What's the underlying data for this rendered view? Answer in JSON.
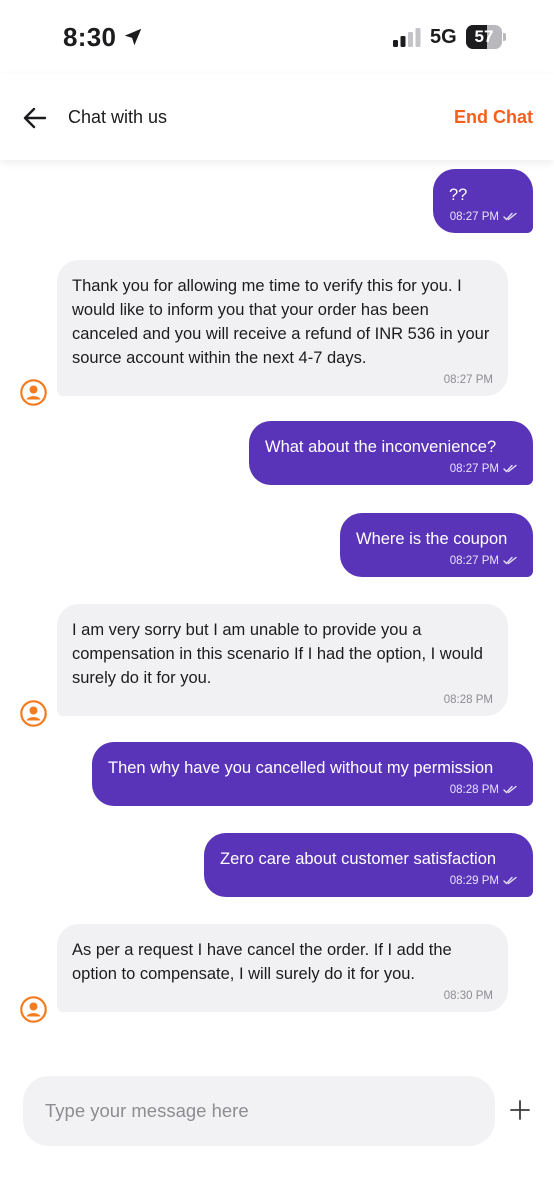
{
  "status_bar": {
    "time": "8:30",
    "network": "5G",
    "battery_level": "57",
    "icons": [
      "location-arrow-icon",
      "signal-bars-icon",
      "battery-icon"
    ]
  },
  "header": {
    "title": "Chat with us",
    "back_icon": "arrow-left-icon",
    "end_chat_label": "End Chat"
  },
  "colors": {
    "accent": "#f3601d",
    "outgoing_bubble": "#5a34b8",
    "incoming_bubble": "#f1f1f4",
    "avatar_ring": "#f47b20"
  },
  "messages": [
    {
      "from": "user",
      "text": "??",
      "time": "08:27 PM"
    },
    {
      "from": "agent",
      "text": "Thank you for allowing me time to verify this for you. I would like to inform you that your order has been canceled and you will receive a refund of INR 536 in your source account within the next 4-7 days.",
      "time": "08:27 PM"
    },
    {
      "from": "user",
      "text": "What about the inconvenience?",
      "time": "08:27 PM"
    },
    {
      "from": "user",
      "text": "Where is the coupon",
      "time": "08:27 PM"
    },
    {
      "from": "agent",
      "text": "I am very sorry but I am unable to provide you a compensation in this scenario If I had the option, I would surely do it for you.",
      "time": "08:28 PM"
    },
    {
      "from": "user",
      "text": "Then why have you cancelled without my permission",
      "time": "08:28 PM"
    },
    {
      "from": "user",
      "text": "Zero care about customer satisfaction",
      "time": "08:29 PM"
    },
    {
      "from": "agent",
      "text": "As per a request I have cancel the order. If I add the option to compensate, I will surely do it for you.",
      "time": "08:30 PM"
    }
  ],
  "composer": {
    "placeholder": "Type your message here",
    "value": "",
    "add_icon": "plus-icon"
  }
}
